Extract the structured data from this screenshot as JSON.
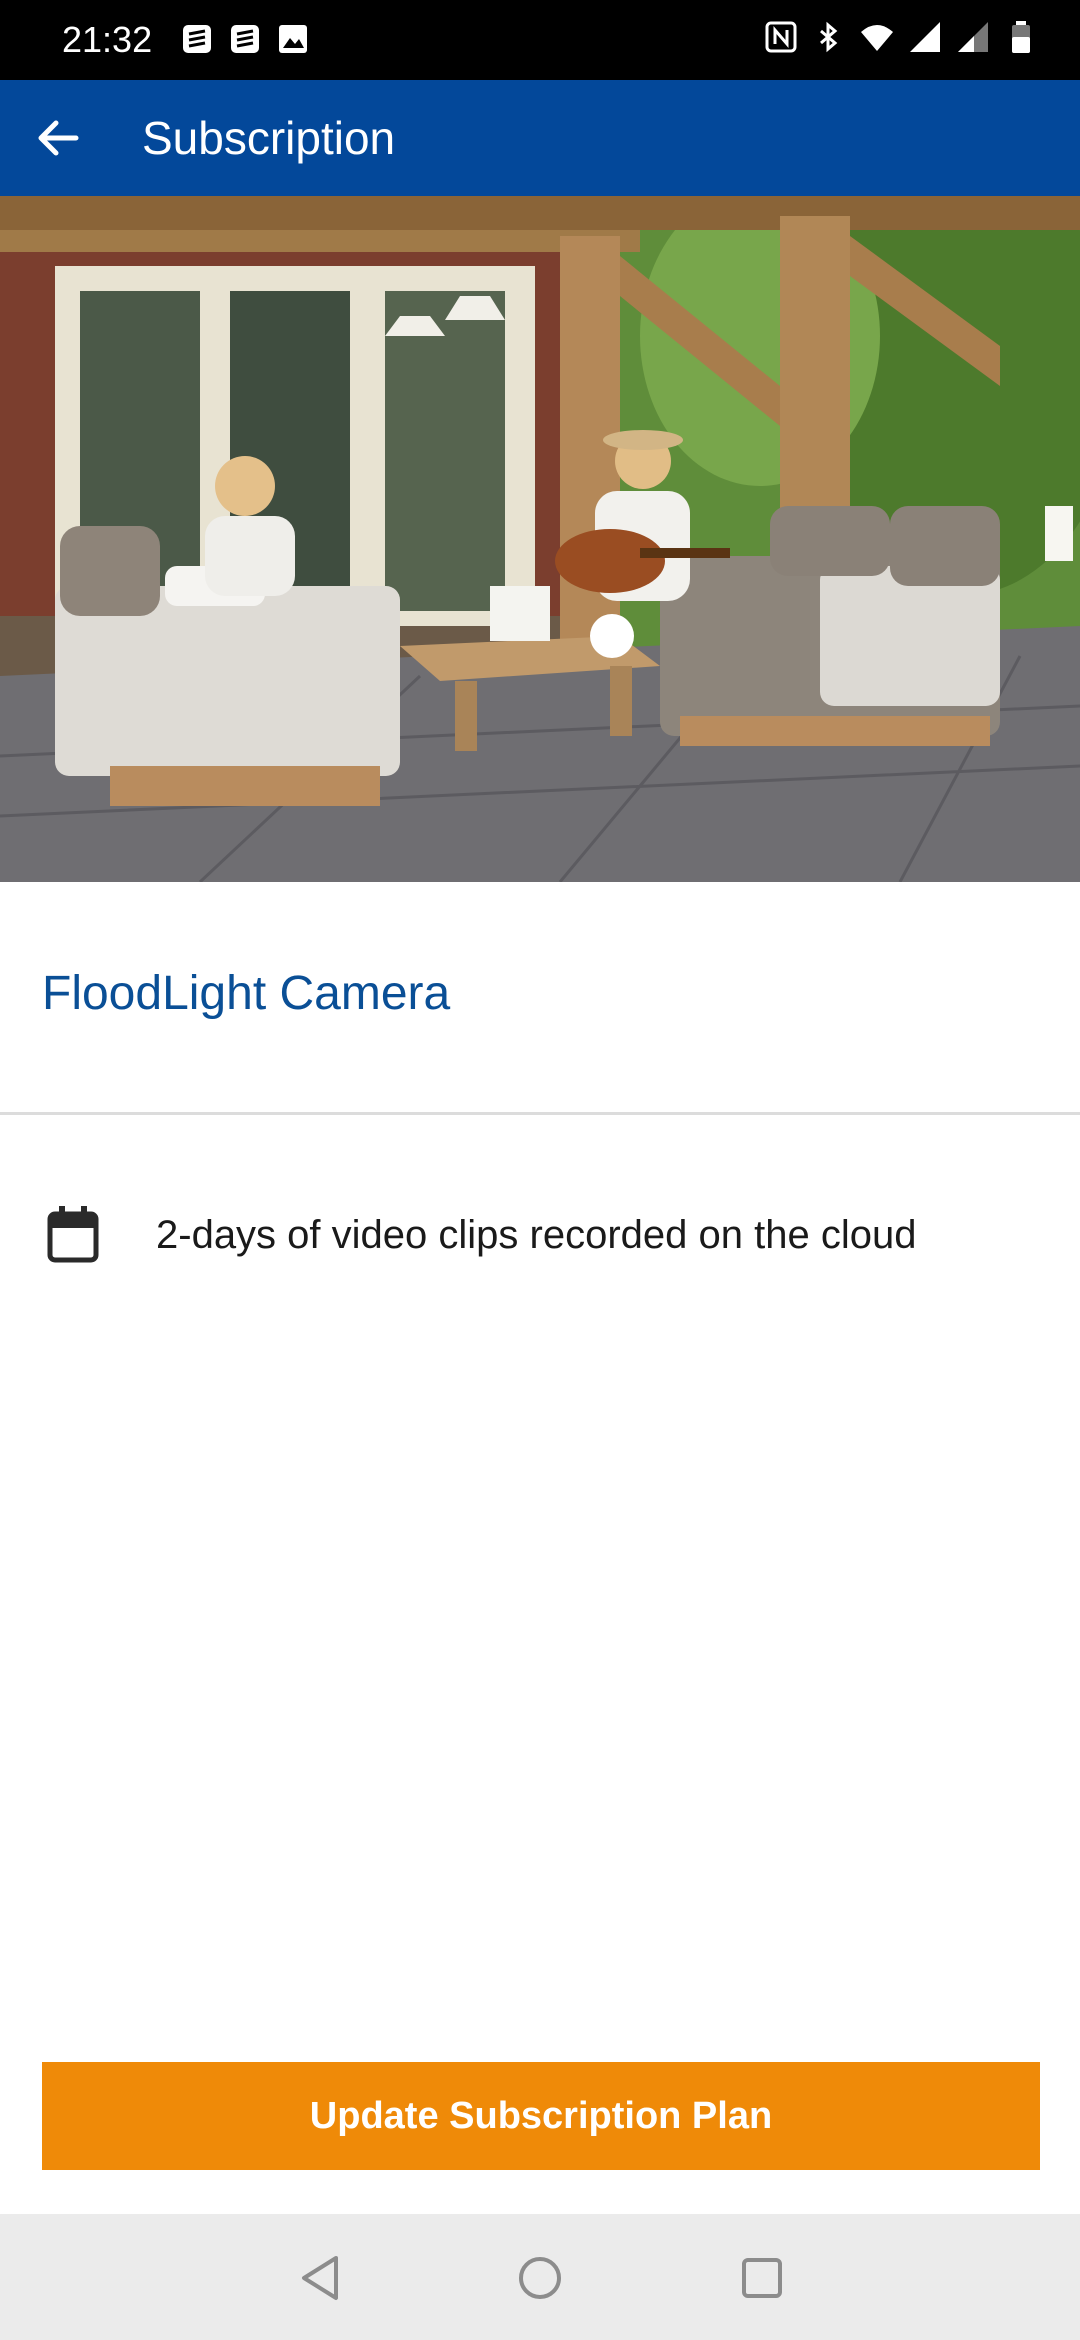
{
  "status_bar": {
    "time": "21:32",
    "left_icons": [
      "notification-stack-icon",
      "notification-stack-icon",
      "image-icon"
    ],
    "right_icons": [
      "nfc-icon",
      "bluetooth-icon",
      "wifi-icon",
      "signal-icon",
      "signal-weak-icon",
      "battery-icon"
    ]
  },
  "app_bar": {
    "title": "Subscription",
    "color": "#03489a"
  },
  "hero": {
    "description_icon": "patio-photo"
  },
  "device": {
    "name": "FloodLight Camera",
    "name_color": "#0a4f96"
  },
  "features": [
    {
      "icon": "calendar-icon",
      "text": "2-days of video clips recorded on the cloud"
    }
  ],
  "actions": {
    "update_label": "Update Subscription Plan",
    "update_color": "#ef8a08"
  },
  "nav_bar": {
    "buttons": [
      "back-triangle-icon",
      "home-circle-icon",
      "recents-square-icon"
    ]
  }
}
